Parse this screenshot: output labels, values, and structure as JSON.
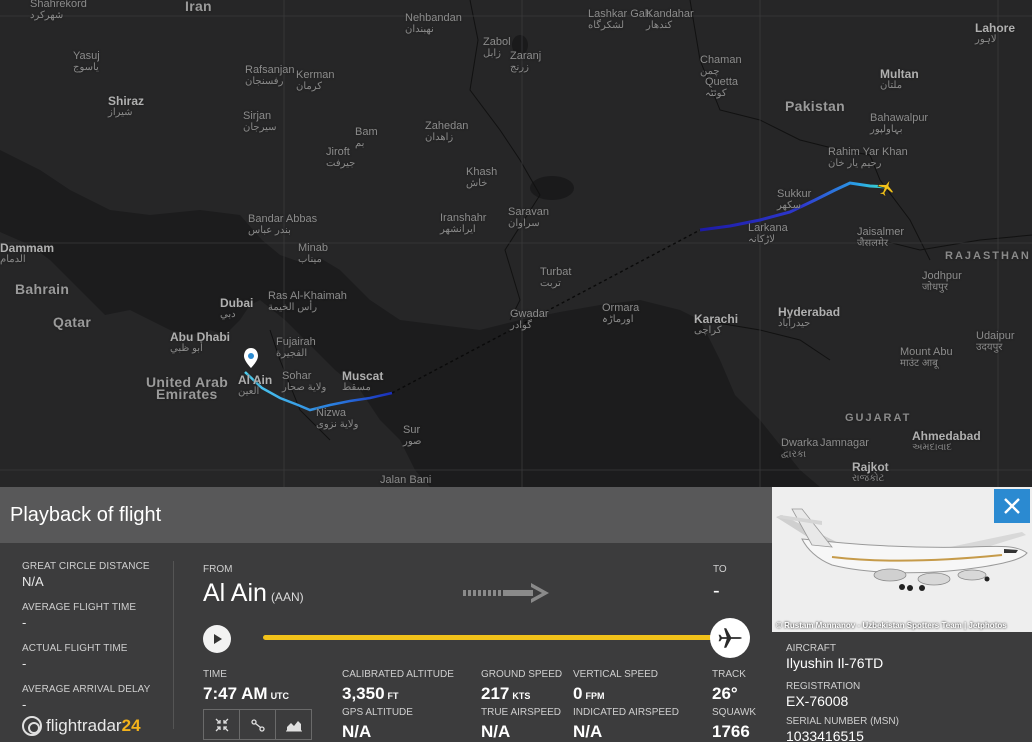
{
  "map": {
    "labels": {
      "shahrekord": "Shahrekord",
      "shahrekord_fa": "شهرکرد",
      "iran": "Iran",
      "nehbandan": "Nehbandan",
      "nehbandan_fa": "نهبندان",
      "lashkar_gah": "Lashkar Gah",
      "lashkar_gah_fa": "لشکرگاه",
      "kandahar": "Kandahar",
      "kandahar_fa": "کندهار",
      "zabol": "Zabol",
      "zabol_fa": "زابل",
      "zaranj": "Zaranj",
      "zaranj_fa": "زرنج",
      "lahore": "Lahore",
      "lahore_fa": "لاہور",
      "yasuj": "Yasuj",
      "yasuj_fa": "یاسوج",
      "rafsanjan": "Rafsanjan",
      "rafsanjan_fa": "رفسنجان",
      "kerman": "Kerman",
      "kerman_fa": "کرمان",
      "chaman": "Chaman",
      "chaman_fa": "چمن",
      "multan": "Multan",
      "multan_fa": "ملتان",
      "shiraz": "Shiraz",
      "shiraz_fa": "شیراز",
      "quetta": "Quetta",
      "quetta_fa": "کوئٹہ",
      "pakistan": "Pakistan",
      "bahawalpur": "Bahawalpur",
      "bahawalpur_fa": "بہاولپور",
      "sirjan": "Sirjan",
      "sirjan_fa": "سیرجان",
      "bam": "Bam",
      "bam_fa": "بم",
      "zahedan": "Zahedan",
      "zahedan_fa": "زاهدان",
      "jiroft": "Jiroft",
      "jiroft_fa": "جیرفت",
      "rahim_yar_khan": "Rahim Yar Khan",
      "rahim_yar_khan_fa": "رحیم یار خان",
      "khash": "Khash",
      "khash_fa": "خاش",
      "sukkur": "Sukkur",
      "sukkur_fa": "سکھر",
      "bandar_abbas": "Bandar Abbas",
      "bandar_abbas_fa": "بندر عباس",
      "iranshahr": "Iranshahr",
      "iranshahr_fa": "ایرانشهر",
      "saravan": "Saravan",
      "saravan_fa": "سراوان",
      "jaisalmer": "Jaisalmer",
      "jaisalmer_fa": "जैसलमेर",
      "larkana": "Larkana",
      "larkana_fa": "لاڑکانہ",
      "dammam": "Dammam",
      "dammam_fa": "الدمام",
      "minab": "Minab",
      "minab_fa": "میناب",
      "rajasthan": "RAJASTHAN",
      "bahrain": "Bahrain",
      "turbat": "Turbat",
      "turbat_fa": "تربت",
      "jodhpur": "Jodhpur",
      "jodhpur_fa": "जोधपुर",
      "dubai": "Dubai",
      "dubai_fa": "دبي",
      "ras_al_khaimah": "Ras Al-Khaimah",
      "ras_al_khaimah_fa": "رأس الخيمة",
      "qatar": "Qatar",
      "gwadar": "Gwadar",
      "gwadar_fa": "گوادر",
      "ormara": "Ormara",
      "ormara_fa": "اورماڑہ",
      "hyderabad": "Hyderabad",
      "hyderabad_fa": "حیدرآباد",
      "fujairah": "Fujairah",
      "fujairah_fa": "الفجيرة",
      "abu_dhabi": "Abu Dhabi",
      "abu_dhabi_fa": "أبو ظبي",
      "karachi": "Karachi",
      "karachi_fa": "کراچی",
      "udaipur": "Udaipur",
      "udaipur_fa": "उदयपुर",
      "sohar": "Sohar",
      "sohar_fa": "ولاية صحار",
      "muscat": "Muscat",
      "muscat_fa": "مسقط",
      "mount_abu": "Mount Abu",
      "mount_abu_fa": "माउंट आबू",
      "uae": "United Arab",
      "uae2": "Emirates",
      "al_ain": "Al Ain",
      "al_ain_fa": "العين",
      "nizwa": "Nizwa",
      "nizwa_fa": "ولاية نزوى",
      "gujarat": "GUJARAT",
      "sur": "Sur",
      "sur_fa": "صور",
      "ahmedabad": "Ahmedabad",
      "ahmedabad_fa": "અમદાવાદ",
      "dwarka": "Dwarka",
      "dwarka_fa": "દ્વારકા",
      "jamnagar": "Jamnagar",
      "rajkot": "Rajkot",
      "rajkot_fa": "રાજકોટ",
      "jalan_bani": "Jalan Bani"
    }
  },
  "panel": {
    "title": "Playback of flight",
    "stats": [
      {
        "label": "GREAT CIRCLE DISTANCE",
        "value": "N/A"
      },
      {
        "label": "AVERAGE FLIGHT TIME",
        "value": "-"
      },
      {
        "label": "ACTUAL FLIGHT TIME",
        "value": "-"
      },
      {
        "label": "AVERAGE ARRIVAL DELAY",
        "value": "-"
      }
    ],
    "from_label": "FROM",
    "from_city": "Al Ain",
    "from_code": "(AAN)",
    "to_label": "TO",
    "to_value": "-",
    "playback_progress": 1.0,
    "brand": "flightradar",
    "brand_num": "24",
    "live": [
      {
        "label": "TIME",
        "value": "7:47 AM",
        "unit": "UTC"
      },
      {
        "label": "CALIBRATED ALTITUDE",
        "value": "3,350",
        "unit": "FT"
      },
      {
        "label": "GROUND SPEED",
        "value": "217",
        "unit": "KTS"
      },
      {
        "label": "VERTICAL SPEED",
        "value": "0",
        "unit": "FPM"
      },
      {
        "label": "TRACK",
        "value": "26°",
        "unit": ""
      },
      {
        "label": "GPS ALTITUDE",
        "value": "N/A",
        "unit": ""
      },
      {
        "label": "TRUE AIRSPEED",
        "value": "N/A",
        "unit": ""
      },
      {
        "label": "INDICATED AIRSPEED",
        "value": "N/A",
        "unit": ""
      },
      {
        "label": "SQUAWK",
        "value": "1766",
        "unit": ""
      }
    ]
  },
  "aircraft": {
    "photo_credit": "© Rustam Mannanov - Uzbekistan Spotters Team | Jetphotos",
    "aircraft_label": "AIRCRAFT",
    "aircraft_value": "Ilyushin Il-76TD",
    "registration_label": "REGISTRATION",
    "registration_value": "EX-76008",
    "serial_label": "SERIAL NUMBER (MSN)",
    "serial_value": "1033416515"
  },
  "colors": {
    "accent_yellow": "#f2c21a",
    "close_blue": "#2b8ad1",
    "track_start": "#3aa8e0",
    "track_end": "#1b1fa8"
  }
}
